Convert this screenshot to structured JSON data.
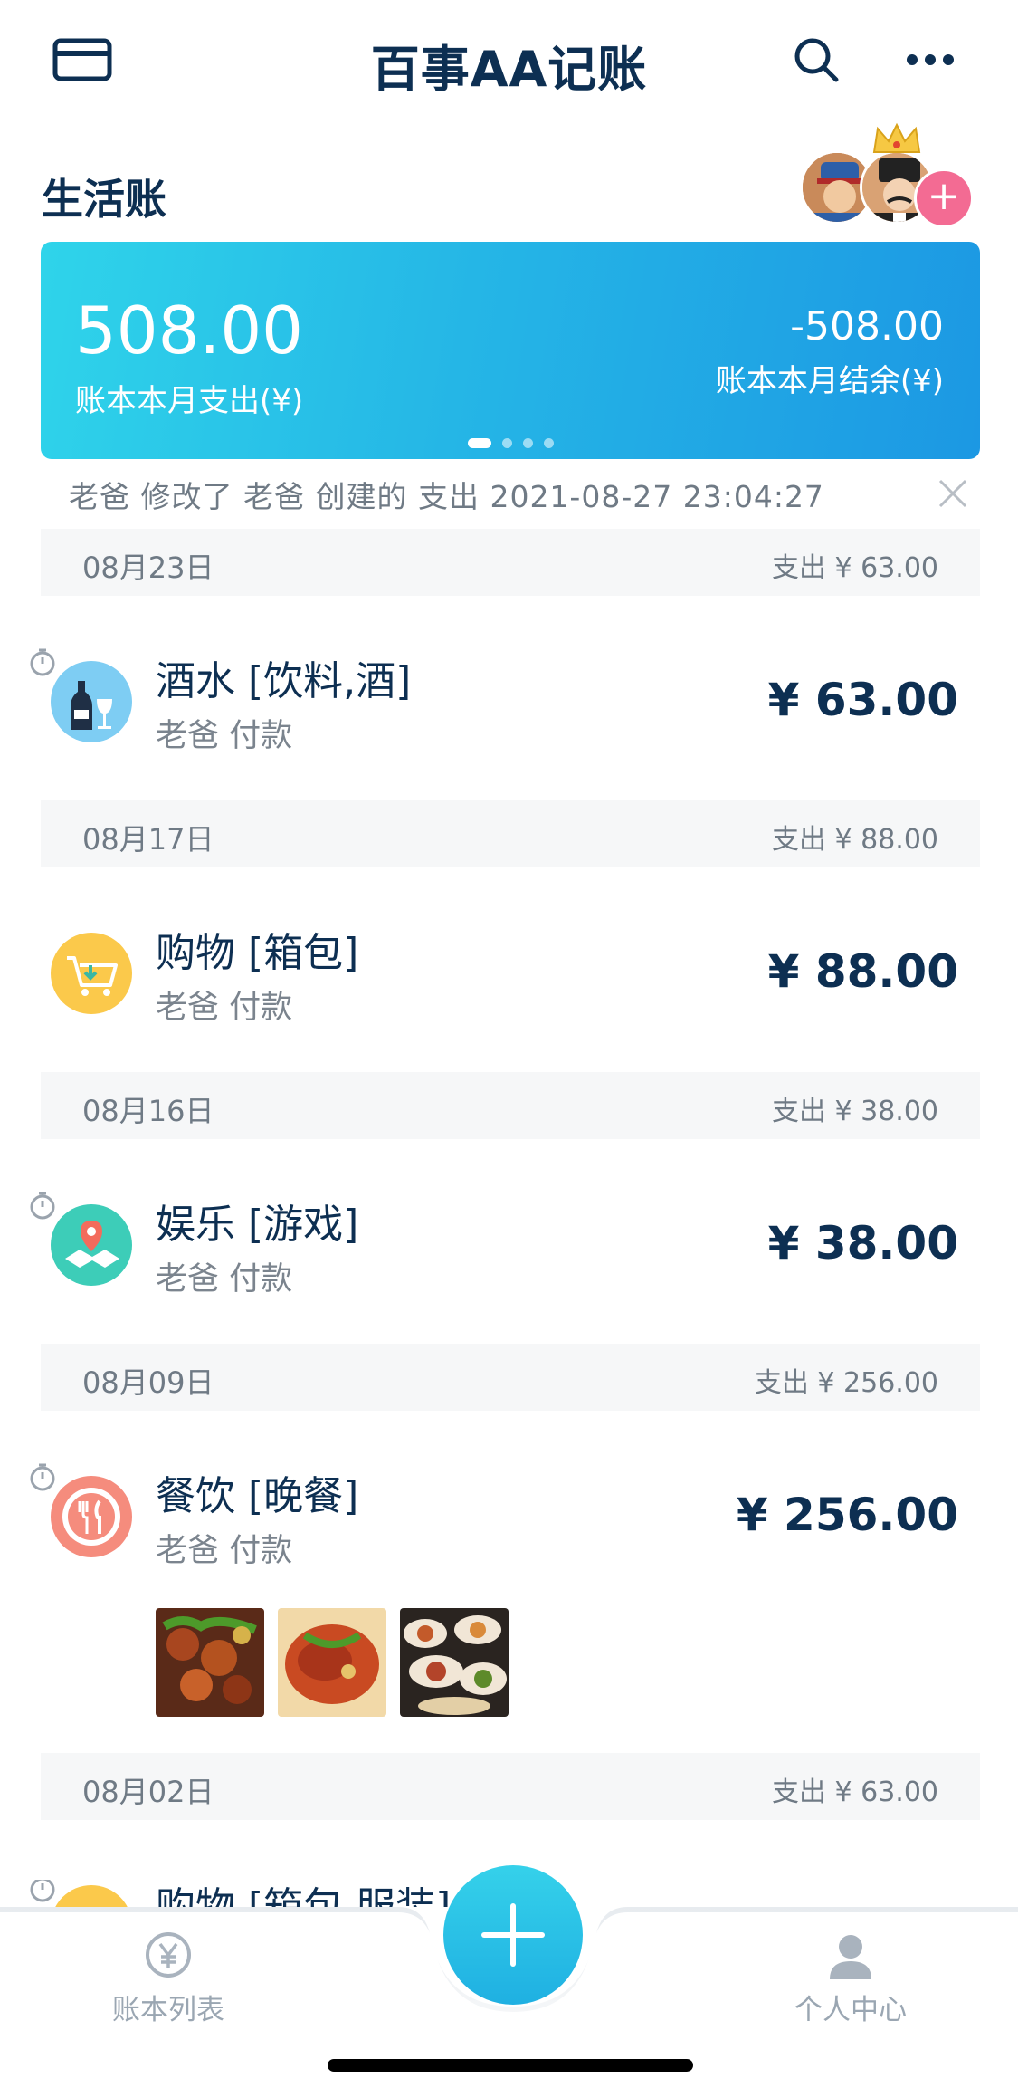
{
  "header": {
    "title": "百事AA记账"
  },
  "book": {
    "name": "生活账",
    "add_member_symbol": "+"
  },
  "summary": {
    "expense_amount": "508.00",
    "expense_label": "账本本月支出(¥)",
    "balance_amount": "-508.00",
    "balance_label": "账本本月结余(¥)",
    "page_count": 4,
    "active_page": 1
  },
  "notice": {
    "text": "老爸  修改了  老爸 创建的  支出   2021-08-27 23:04:27"
  },
  "groups": [
    {
      "date": "08月23日",
      "summary": "支出 ¥ 63.00",
      "record": {
        "title": "酒水 [饮料,酒]",
        "payer": "老爸  付款",
        "amount": "¥ 63.00",
        "icon": "wine-icon",
        "icon_color": "#7ecdf3"
      }
    },
    {
      "date": "08月17日",
      "summary": "支出 ¥ 88.00",
      "record": {
        "title": "购物 [箱包]",
        "payer": "老爸  付款",
        "amount": "¥ 88.00",
        "icon": "shopping-cart-icon",
        "icon_color": "#fbc94b"
      }
    },
    {
      "date": "08月16日",
      "summary": "支出 ¥ 38.00",
      "record": {
        "title": "娱乐 [游戏]",
        "payer": "老爸  付款",
        "amount": "¥ 38.00",
        "icon": "map-pin-icon",
        "icon_color": "#3dcdb8"
      }
    },
    {
      "date": "08月09日",
      "summary": "支出 ¥ 256.00",
      "record": {
        "title": "餐饮 [晚餐]",
        "payer": "老爸  付款",
        "amount": "¥ 256.00",
        "icon": "fork-knife-icon",
        "icon_color": "#f58c7d"
      }
    },
    {
      "date": "08月02日",
      "summary": "支出 ¥ 63.00",
      "record": {
        "title": "购物 [箱包,服装]",
        "icon": "shopping-cart-icon",
        "icon_color": "#fbc94b"
      }
    }
  ],
  "nav": {
    "books_label": "账本列表",
    "me_label": "个人中心",
    "fab_symbol": "+"
  },
  "colors": {
    "primary": "#0d2f52",
    "accent": "#25b6e6",
    "pink": "#f36b93",
    "muted": "#7b848e"
  }
}
